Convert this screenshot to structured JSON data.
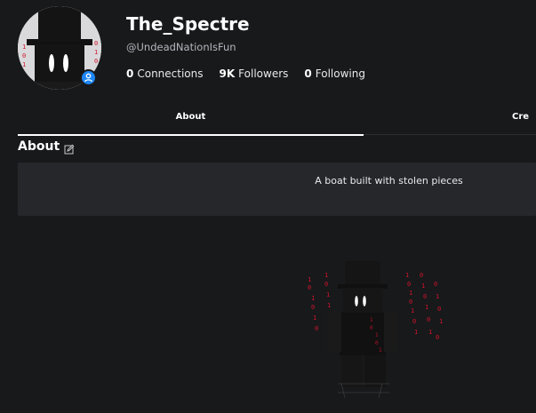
{
  "profile": {
    "display_name": "The_Spectre",
    "username": "@UndeadNationIsFun",
    "stats": [
      {
        "value": "0",
        "label": "Connections"
      },
      {
        "value": "9K",
        "label": "Followers"
      },
      {
        "value": "0",
        "label": "Following"
      }
    ],
    "presence_icon": "user-icon"
  },
  "tabs": [
    {
      "label": "About",
      "active": true
    },
    {
      "label": "Cre",
      "active": false
    }
  ],
  "about": {
    "title": "About",
    "edit_icon": "edit-icon",
    "description": "A boat built with stolen pieces"
  },
  "colors": {
    "background": "#18191b",
    "card": "#25272b",
    "presence_blue": "#1d86f5",
    "muted_text": "#b3b6bb",
    "binary_red": "#d0142c"
  },
  "avatar_render": {
    "icon": "avatar-3d-icon"
  }
}
